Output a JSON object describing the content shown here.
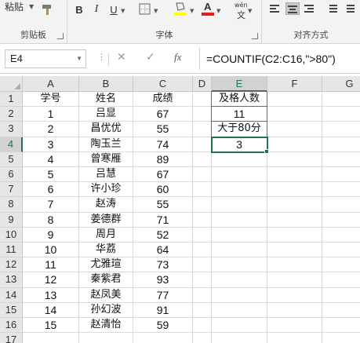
{
  "ribbon": {
    "clipboard": {
      "paste_label": "粘贴",
      "group_label": "剪贴板"
    },
    "font": {
      "bold_label": "B",
      "italic_label": "I",
      "underline_label": "U",
      "wen_label": "wén",
      "group_label": "字体"
    },
    "alignment": {
      "group_label": "对齐方式"
    },
    "colors": {
      "highlight": "#ffff00",
      "font_color": "#e02020"
    }
  },
  "formula_bar": {
    "name_box": "E4",
    "cancel_icon": "✕",
    "enter_icon": "✓",
    "fx_label": "fx",
    "formula": "=COUNTIF(C2:C16,\">80\")"
  },
  "sheet": {
    "columns": [
      "A",
      "B",
      "C",
      "D",
      "E",
      "F",
      "G"
    ],
    "rows": [
      "1",
      "2",
      "3",
      "4",
      "5",
      "6",
      "7",
      "8",
      "9",
      "10",
      "11",
      "12",
      "13",
      "14",
      "15",
      "16",
      "17"
    ],
    "active_cell": "E4",
    "accent_color": "#217346",
    "table": {
      "headers": [
        "学号",
        "姓名",
        "成绩"
      ],
      "rows": [
        [
          "1",
          "吕显",
          "67"
        ],
        [
          "2",
          "昌优优",
          "55"
        ],
        [
          "3",
          "陶玉兰",
          "74"
        ],
        [
          "4",
          "曾寒雁",
          "89"
        ],
        [
          "5",
          "吕慧",
          "67"
        ],
        [
          "6",
          "许小珍",
          "60"
        ],
        [
          "7",
          "赵涛",
          "55"
        ],
        [
          "8",
          "姜德群",
          "71"
        ],
        [
          "9",
          "周月",
          "52"
        ],
        [
          "10",
          "华荔",
          "64"
        ],
        [
          "11",
          "尤雅瑄",
          "73"
        ],
        [
          "12",
          "秦紫君",
          "93"
        ],
        [
          "13",
          "赵凤美",
          "77"
        ],
        [
          "14",
          "孙幻波",
          "91"
        ],
        [
          "15",
          "赵清怡",
          "59"
        ]
      ]
    },
    "summary": {
      "e1": "及格人数",
      "e2": "11",
      "e3": "大于80分",
      "e4": "3"
    }
  }
}
